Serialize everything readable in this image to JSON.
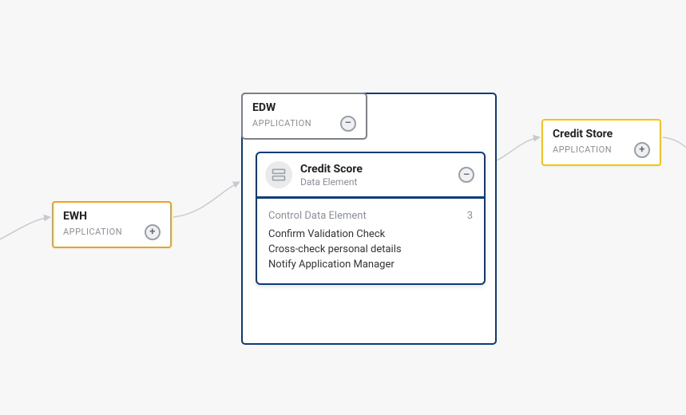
{
  "nodes": {
    "ewh": {
      "title": "EWH",
      "subtitle": "APPLICATION"
    },
    "edw_tab": {
      "title": "EDW",
      "subtitle": "APPLICATION"
    },
    "credit_store": {
      "title": "Credit Store",
      "subtitle": "APPLICATION"
    }
  },
  "credit_score": {
    "title": "Credit Score",
    "subtitle": "Data Element",
    "body_header": "Control Data Element",
    "count": "3",
    "items": [
      "Confirm Validation Check",
      "Cross-check personal details",
      "Notify Application Manager"
    ]
  }
}
